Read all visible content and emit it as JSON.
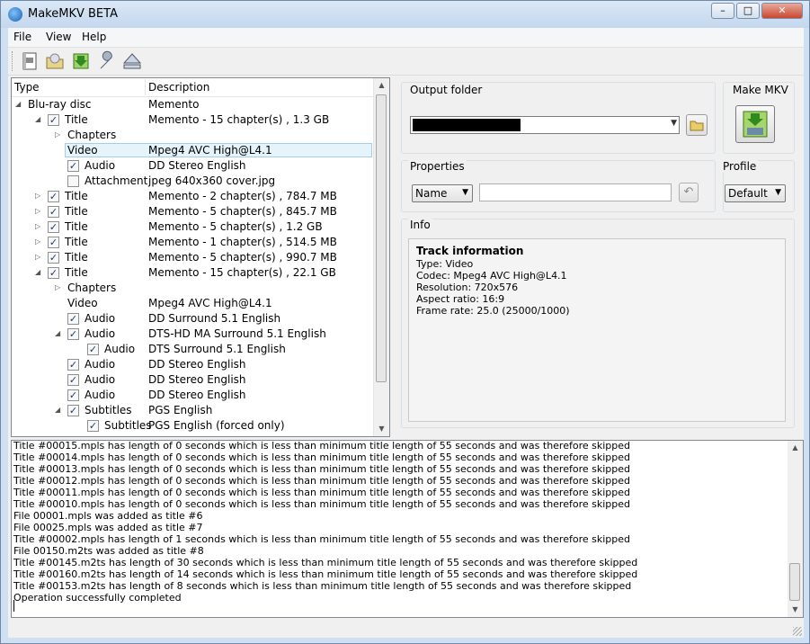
{
  "window": {
    "title": "MakeMKV BETA",
    "minimize": "–",
    "maximize": "□",
    "close": "✕"
  },
  "menu": {
    "items": [
      {
        "label": "File"
      },
      {
        "label": "View"
      },
      {
        "label": "Help"
      }
    ]
  },
  "toolbar": {
    "buttons": [
      {
        "icon": "open-files-icon"
      },
      {
        "icon": "open-disc-icon"
      },
      {
        "icon": "backup-icon"
      },
      {
        "icon": "preferences-wrench-icon"
      },
      {
        "icon": "eject-icon"
      }
    ]
  },
  "tree": {
    "columns": {
      "type": "Type",
      "description": "Description"
    },
    "rows": [
      {
        "label": "Blu-ray disc",
        "desc": "Memento",
        "level": 0,
        "expander": "open",
        "checkbox": "none"
      },
      {
        "label": "Title",
        "desc": "Memento - 15 chapter(s) , 1.3 GB",
        "level": 1,
        "expander": "open",
        "checkbox": "checked"
      },
      {
        "label": "Chapters",
        "desc": "",
        "level": 2,
        "expander": "closed",
        "checkbox": "none"
      },
      {
        "label": "Video",
        "desc": "Mpeg4 AVC High@L4.1",
        "level": 2,
        "expander": "none",
        "checkbox": "none",
        "selected": true
      },
      {
        "label": "Audio",
        "desc": "DD Stereo English",
        "level": 2,
        "expander": "none",
        "checkbox": "checked"
      },
      {
        "label": "Attachment",
        "desc": "jpeg 640x360 cover.jpg",
        "level": 2,
        "expander": "none",
        "checkbox": "unchecked"
      },
      {
        "label": "Title",
        "desc": "Memento - 2 chapter(s) , 784.7 MB",
        "level": 1,
        "expander": "closed",
        "checkbox": "checked"
      },
      {
        "label": "Title",
        "desc": "Memento - 5 chapter(s) , 845.7 MB",
        "level": 1,
        "expander": "closed",
        "checkbox": "checked"
      },
      {
        "label": "Title",
        "desc": "Memento - 5 chapter(s) , 1.2 GB",
        "level": 1,
        "expander": "closed",
        "checkbox": "checked"
      },
      {
        "label": "Title",
        "desc": "Memento - 1 chapter(s) , 514.5 MB",
        "level": 1,
        "expander": "closed",
        "checkbox": "checked"
      },
      {
        "label": "Title",
        "desc": "Memento - 5 chapter(s) , 990.7 MB",
        "level": 1,
        "expander": "closed",
        "checkbox": "checked"
      },
      {
        "label": "Title",
        "desc": "Memento - 15 chapter(s) , 22.1 GB",
        "level": 1,
        "expander": "open",
        "checkbox": "checked"
      },
      {
        "label": "Chapters",
        "desc": "",
        "level": 2,
        "expander": "closed",
        "checkbox": "none"
      },
      {
        "label": "Video",
        "desc": "Mpeg4 AVC High@L4.1",
        "level": 2,
        "expander": "none",
        "checkbox": "none"
      },
      {
        "label": "Audio",
        "desc": "DD Surround 5.1 English",
        "level": 2,
        "expander": "none",
        "checkbox": "checked"
      },
      {
        "label": "Audio",
        "desc": "DTS-HD MA Surround 5.1 English",
        "level": 2,
        "expander": "open",
        "checkbox": "checked"
      },
      {
        "label": "Audio",
        "desc": "DTS Surround 5.1 English",
        "level": 3,
        "expander": "none",
        "checkbox": "checked"
      },
      {
        "label": "Audio",
        "desc": "DD Stereo English",
        "level": 2,
        "expander": "none",
        "checkbox": "checked"
      },
      {
        "label": "Audio",
        "desc": "DD Stereo English",
        "level": 2,
        "expander": "none",
        "checkbox": "checked"
      },
      {
        "label": "Audio",
        "desc": "DD Stereo English",
        "level": 2,
        "expander": "none",
        "checkbox": "checked"
      },
      {
        "label": "Subtitles",
        "desc": "PGS English",
        "level": 2,
        "expander": "open",
        "checkbox": "checked"
      },
      {
        "label": "Subtitles",
        "desc": "PGS English  (forced only)",
        "level": 3,
        "expander": "none",
        "checkbox": "checked"
      }
    ]
  },
  "output": {
    "label": "Output folder"
  },
  "make_mkv": {
    "label": "Make MKV"
  },
  "properties": {
    "label": "Properties",
    "name_select": "Name",
    "value": ""
  },
  "profile": {
    "label": "Profile",
    "value": "Default"
  },
  "info": {
    "label": "Info",
    "title": "Track information",
    "lines": [
      "Type: Video",
      "Codec: Mpeg4 AVC High@L4.1",
      "Resolution: 720x576",
      "Aspect ratio: 16:9",
      "Frame rate: 25.0 (25000/1000)"
    ]
  },
  "log": {
    "lines": [
      "Title #00015.mpls has length of 0 seconds which is less than minimum title length of 55 seconds and was therefore skipped",
      "Title #00014.mpls has length of 0 seconds which is less than minimum title length of 55 seconds and was therefore skipped",
      "Title #00013.mpls has length of 0 seconds which is less than minimum title length of 55 seconds and was therefore skipped",
      "Title #00012.mpls has length of 0 seconds which is less than minimum title length of 55 seconds and was therefore skipped",
      "Title #00011.mpls has length of 0 seconds which is less than minimum title length of 55 seconds and was therefore skipped",
      "Title #00010.mpls has length of 0 seconds which is less than minimum title length of 55 seconds and was therefore skipped",
      "File 00001.mpls was added as title #6",
      "File 00025.mpls was added as title #7",
      "Title #00002.mpls has length of 1 seconds which is less than minimum title length of 55 seconds and was therefore skipped",
      "File 00150.m2ts was added as title #8",
      "Title #00145.m2ts has length of 30 seconds which is less than minimum title length of 55 seconds and was therefore skipped",
      "Title #00160.m2ts has length of 14 seconds which is less than minimum title length of 55 seconds and was therefore skipped",
      "Title #00153.m2ts has length of 8 seconds which is less than minimum title length of 55 seconds and was therefore skipped",
      "Operation successfully completed"
    ]
  }
}
